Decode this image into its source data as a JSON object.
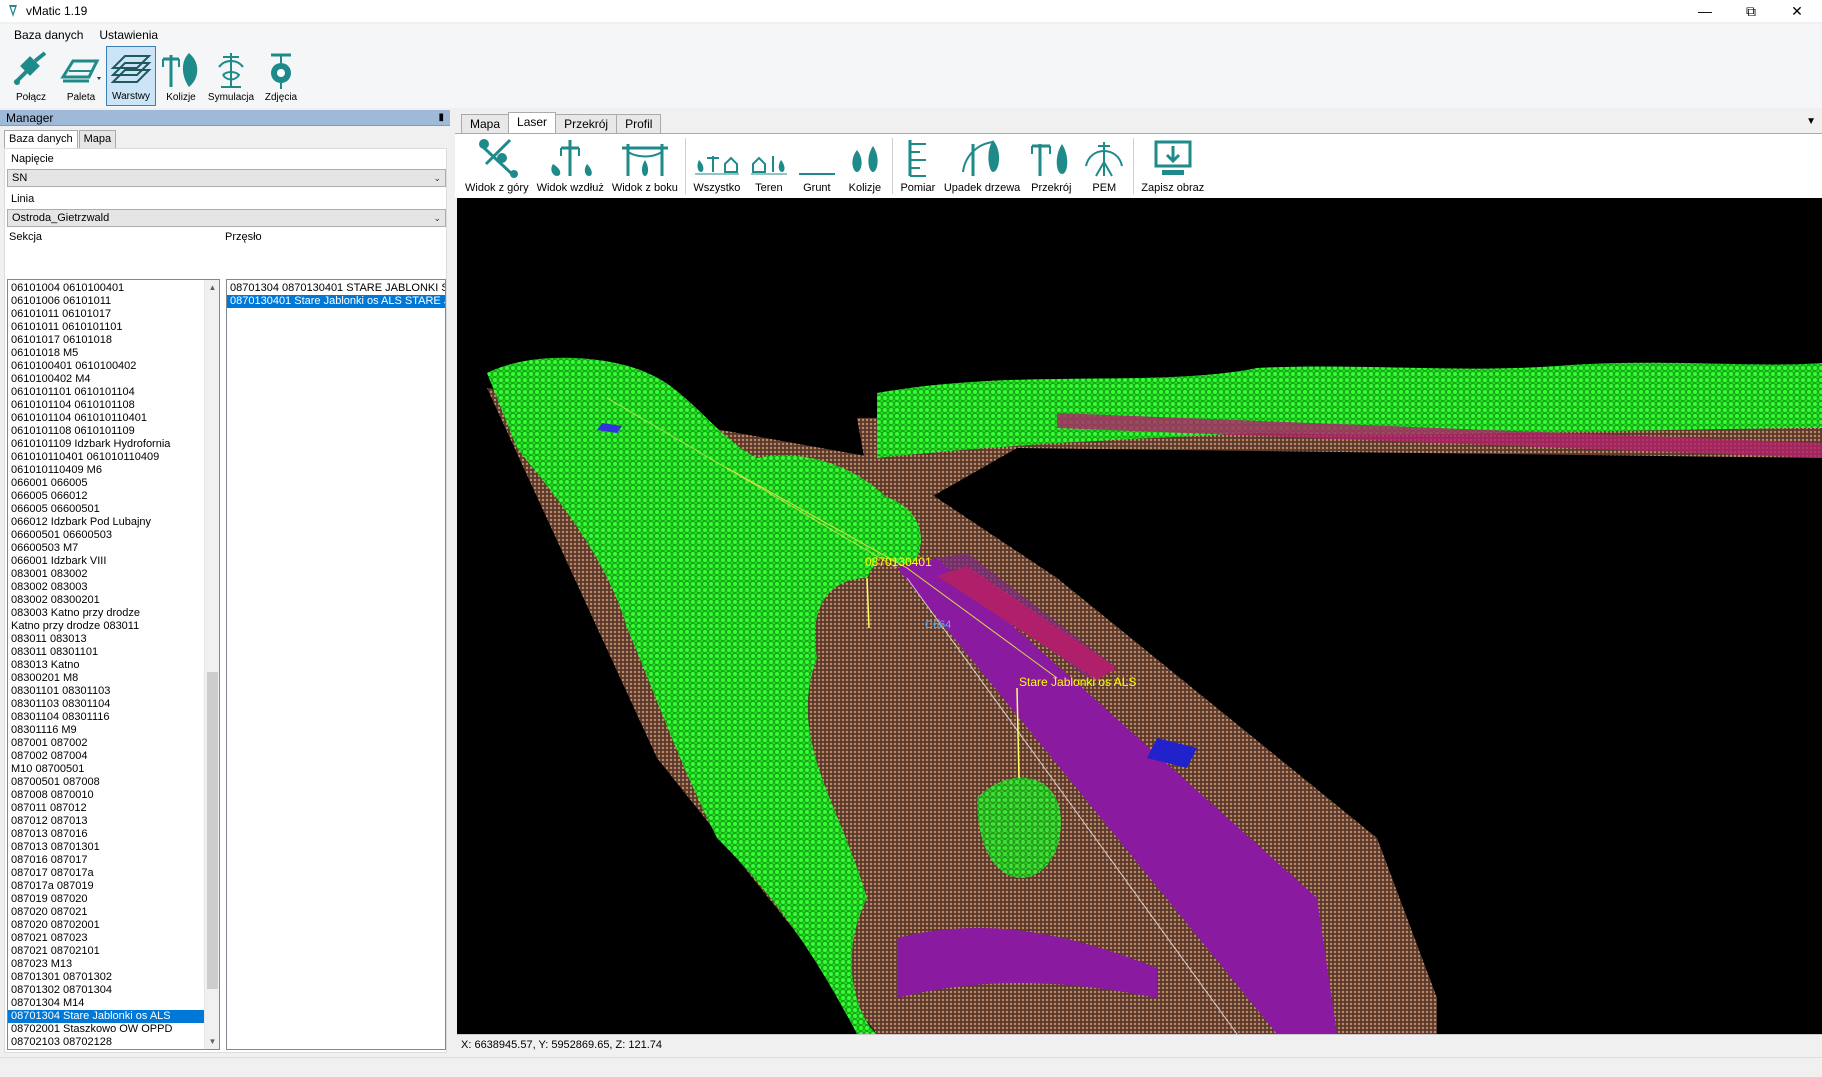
{
  "window": {
    "title": "vMatic 1.19"
  },
  "menu": [
    "Baza danych",
    "Ustawienia"
  ],
  "toolbar": {
    "buttons": [
      {
        "label": "Połącz",
        "icon": "connect-icon"
      },
      {
        "label": "Paleta",
        "icon": "palette-icon"
      },
      {
        "label": "Warstwy",
        "icon": "layers-icon",
        "active": true
      },
      {
        "label": "Kolizje",
        "icon": "collision-icon"
      },
      {
        "label": "Symulacja",
        "icon": "simulation-icon"
      },
      {
        "label": "Zdjęcia",
        "icon": "photos-icon"
      }
    ]
  },
  "manager": {
    "title": "Manager",
    "pin": "📌",
    "tabs": [
      "Baza danych",
      "Mapa"
    ],
    "napiecie": {
      "label": "Napięcie",
      "value": "SN"
    },
    "linia": {
      "label": "Linia",
      "value": "Ostroda_Gietrzwald"
    },
    "sekcja_label": "Sekcja",
    "przeslo_label": "Przęsło",
    "sekcje": [
      "06101004 0610100401",
      "06101006 06101011",
      "06101011 06101017",
      "06101011 0610101101",
      "06101017 06101018",
      "06101018 M5",
      "0610100401 0610100402",
      "0610100402 M4",
      "0610101101 0610101104",
      "0610101104 0610101108",
      "0610101104 061010110401",
      "0610101108 0610101109",
      "0610101109 Idzbark Hydrofornia",
      "061010110401 061010110409",
      "061010110409 M6",
      "066001 066005",
      "066005 066012",
      "066005 06600501",
      "066012 Idzbark Pod Lubajny",
      "06600501 06600503",
      "06600503 M7",
      "066001 Idzbark VIII",
      "083001 083002",
      "083002 083003",
      "083002 08300201",
      "083003 Katno przy drodze",
      "Katno przy drodze 083011",
      "083011 083013",
      "083011 08301101",
      "083013 Katno",
      "08300201 M8",
      "08301101 08301103",
      "08301103 08301104",
      "08301104 08301116",
      "08301116 M9",
      "087001 087002",
      "087002 087004",
      "M10 08700501",
      "08700501 087008",
      "087008 0870010",
      "087011 087012",
      "087012 087013",
      "087013 087016",
      "087013 08701301",
      "087016 087017",
      "087017 087017a",
      "087017a 087019",
      "087019 087020",
      "087020 087021",
      "087020 08702001",
      "087021 087023",
      "087021 08702101",
      "087023 M13",
      "08701301 08701302",
      "08701302 08701304",
      "08701304 M14",
      "08701304 Stare Jablonki os ALS",
      "08702001 Staszkowo OW OPPD",
      "08702103 08702128"
    ],
    "sekcje_selected": "08701304 Stare Jablonki os ALS",
    "przesla": [
      "08701304 0870130401 STARE JABLONKI S",
      "0870130401 Stare Jablonki os ALS STARE J"
    ],
    "przeslo_selected": "0870130401 Stare Jablonki os ALS STARE J"
  },
  "view_tabs": [
    "Mapa",
    "Laser",
    "Przekrój",
    "Profil"
  ],
  "view_tabs_active": "Laser",
  "laser_toolbar": [
    {
      "label": "Widok z góry",
      "icon": "top-view-icon"
    },
    {
      "label": "Widok wzdłuż",
      "icon": "along-view-icon"
    },
    {
      "label": "Widok z boku",
      "icon": "side-view-icon"
    },
    {
      "label": "Wszystko",
      "icon": "all-icon"
    },
    {
      "label": "Teren",
      "icon": "terrain-icon"
    },
    {
      "label": "Grunt",
      "icon": "ground-icon"
    },
    {
      "label": "Kolizje",
      "icon": "collisions-icon"
    },
    {
      "label": "Pomiar",
      "icon": "measure-icon"
    },
    {
      "label": "Upadek drzewa",
      "icon": "tree-fall-icon"
    },
    {
      "label": "Przekrój",
      "icon": "cross-section-icon"
    },
    {
      "label": "PEM",
      "icon": "pem-icon"
    },
    {
      "label": "Zapisz obraz",
      "icon": "save-image-icon"
    }
  ],
  "viewport": {
    "labels": {
      "pole1": "0870130401",
      "pole2": "Stare Jablonki os ALS",
      "span": "C664"
    },
    "colors": {
      "vegetation": "#22e522",
      "ground": "#a0725a",
      "road": "#8a1aa0",
      "building": "#b0206a",
      "label": "#ffff00"
    }
  },
  "status": {
    "coords": "X: 6638945.57, Y: 5952869.65, Z: 121.74"
  }
}
